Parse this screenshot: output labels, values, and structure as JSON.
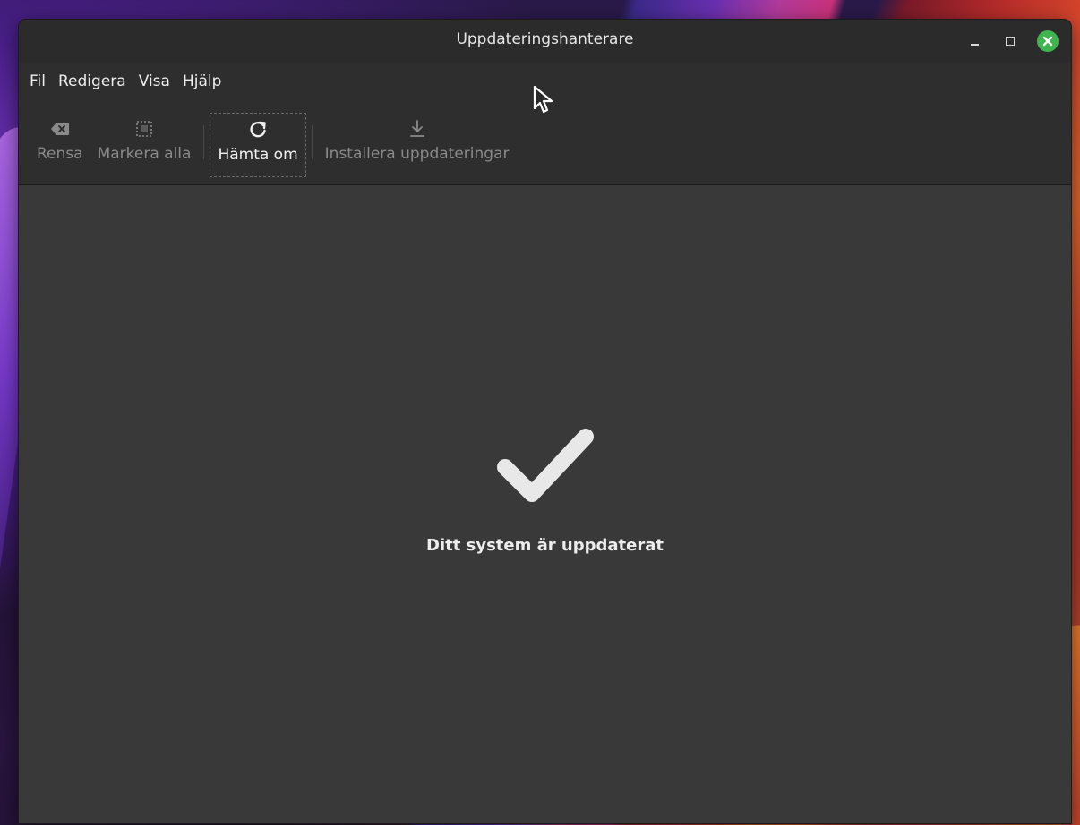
{
  "window": {
    "title": "Uppdateringshanterare"
  },
  "menubar": {
    "items": [
      "Fil",
      "Redigera",
      "Visa",
      "Hjälp"
    ]
  },
  "toolbar": {
    "clear_label": "Rensa",
    "select_all_label": "Markera alla",
    "refresh_label": "Hämta om",
    "install_label": "Installera uppdateringar"
  },
  "main": {
    "status": "Ditt system är uppdaterat"
  },
  "colors": {
    "close_button": "#3fb44f",
    "window_bg": "#393939",
    "titlebar_bg": "#2b2b2b"
  },
  "icons": {
    "clear": "backspace-icon",
    "select_all": "select-all-icon",
    "refresh": "refresh-icon",
    "install": "download-icon",
    "status": "checkmark-icon"
  }
}
